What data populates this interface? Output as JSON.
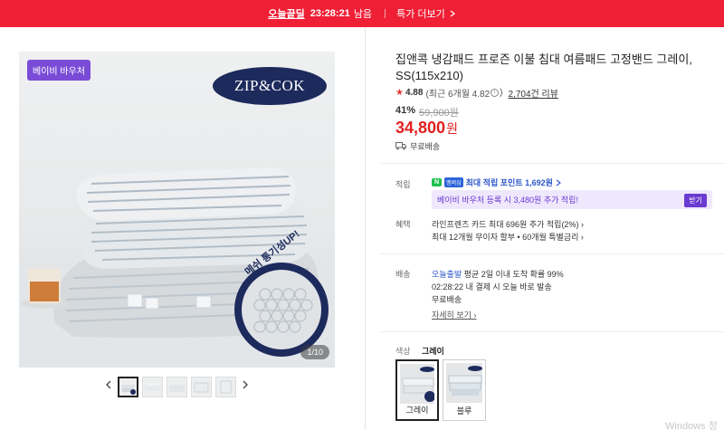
{
  "banner": {
    "deal_label": "오늘끝딜",
    "time": "23:28:21",
    "remain": "남음",
    "more": "특가 더보기",
    "more_icon": "chevron-right-icon"
  },
  "gallery": {
    "voucher_badge": "베이비 바우처",
    "brand_logo": "ZIP&COK",
    "overlay_text": "메쉬 통기성UP!",
    "counter": "1/10",
    "prev_icon": "chevron-left-icon",
    "next_icon": "chevron-right-icon",
    "thumbnails_count": 5
  },
  "product": {
    "title": "집앤콕 냉감패드 프로즌 이불 침대 여름패드 고정밴드 그레이, SS(115x210)",
    "rating": "4.88",
    "recent_rating": "(최근 6개월 4.82",
    "recent_close": ")",
    "review_count": "2,704건 리뷰",
    "discount_pct": "41%",
    "original_price": "59,900원",
    "price": "34,800",
    "price_unit": "원",
    "shipping_free": "무료배송"
  },
  "points": {
    "label": "적립",
    "npay": "N",
    "membership": "멤버십",
    "max_point": "최대 적립 포인트 1,692원",
    "voucher_text": "베이비 바우처 등록 시 3,480원 추가 적립!",
    "voucher_button": "받기"
  },
  "benefits": {
    "label": "혜택",
    "line1": "라인프렌즈 카드 최대 696원 추가 적립(2%)",
    "line2": "최대 12개월 무이자 할부 • 60개월 특별금리"
  },
  "delivery": {
    "label": "배송",
    "today": "오늘출발",
    "info1": "평균 2일 이내 도착 확률 99%",
    "info2": "02:28:22  내 결제 시 오늘 바로 발송",
    "info3": "무료배송",
    "detail_link": "자세히 보기"
  },
  "options": {
    "label": "색상",
    "selected": "그레이",
    "items": [
      {
        "name": "그레이"
      },
      {
        "name": "블루"
      }
    ]
  },
  "watermark": "Windows 정",
  "colors": {
    "banner_red": "#ef1f36",
    "price_red": "#e02020",
    "voucher_purple": "#6a3bd0",
    "brand_navy": "#1d2a5c",
    "link_blue": "#2b55c9"
  }
}
